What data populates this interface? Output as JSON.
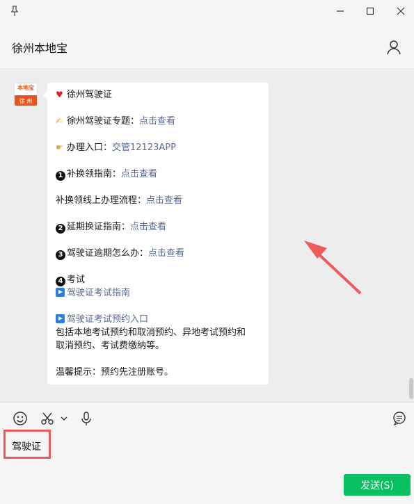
{
  "header": {
    "title": "徐州本地宝"
  },
  "avatar": {
    "top_text": "本地宝",
    "bottom_text": "徐 州"
  },
  "message": {
    "line1": "徐州驾驶证",
    "line2_text": "徐州驾驶证专题：",
    "line2_link": "点击查看",
    "line3_text": "办理入口：",
    "line3_link": "交管12123APP",
    "line4_num": "1",
    "line4_text": "补换领指南：",
    "line4_link": "点击查看",
    "line5_text": "补换领线上办理流程：",
    "line5_link": "点击查看",
    "line6_num": "2",
    "line6_text": "延期换证指南：",
    "line6_link": "点击查看",
    "line7_num": "3",
    "line7_text": "驾驶证逾期怎么办：",
    "line7_link": "点击查看",
    "line8_num": "4",
    "line8_text": "考试",
    "line9_link": "驾驶证考试指南",
    "line10_link": "驾驶证考试预约入口",
    "line11": "包括本地考试预约和取消预约、异地考试预约和",
    "line12": "取消预约、考试费缴纳等。",
    "line13": "温馨提示：预约先注册账号。"
  },
  "input": {
    "value": "驾驶证"
  },
  "send_label": "发送(S)",
  "colors": {
    "link": "#576b95",
    "send": "#07c160",
    "highlight": "#ee5a5a"
  }
}
